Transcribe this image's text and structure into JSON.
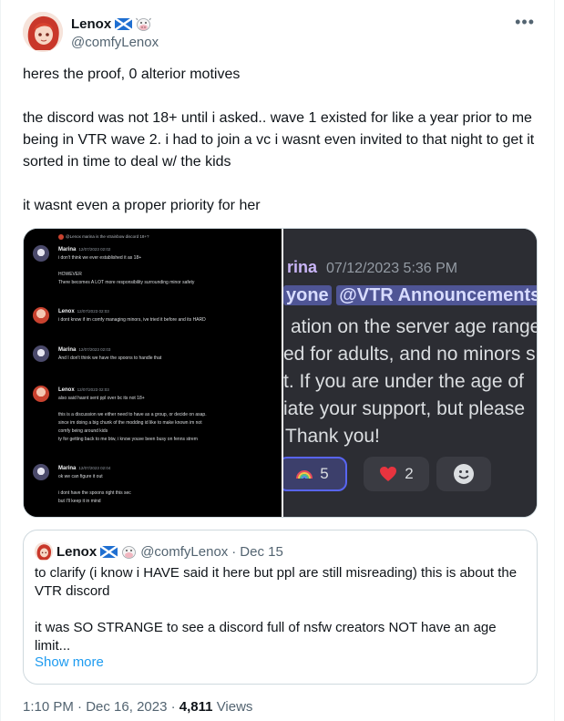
{
  "author": {
    "display_name": "Lenox",
    "handle": "@comfyLenox",
    "name_emojis": [
      "scotland-flag-icon",
      "cow-icon"
    ]
  },
  "more_label": "•••",
  "tweet": {
    "paragraphs": [
      "heres the proof, 0 alterior motives",
      "the discord was not 18+ until i asked.. wave 1 existed for like a year prior to me being in VTR wave 2. i had to join a vc i wasnt even invited to that night to get it sorted in time to deal w/ the kids",
      "it wasnt even a proper priority for her"
    ]
  },
  "media": {
    "left_dm": {
      "reply_line": "@Lenox  marina is the vtrainbow discord 18+?",
      "messages": [
        {
          "name": "Marina",
          "time": "12/07/2023 02:02",
          "lines": [
            "i don't think we ever established it as 18+",
            "",
            "HOWEVER",
            "There becomes A LOT more responsibility surrounding minor safety"
          ]
        },
        {
          "name": "Lenox",
          "time": "12/07/2023 02:03",
          "lines": [
            "i dont know if im comfy managing minors, ive tried it before and its HARD"
          ]
        },
        {
          "name": "Marina",
          "time": "12/07/2023 02:03",
          "lines": [
            "And I don't think we have the spoons to handle that"
          ]
        },
        {
          "name": "Lenox",
          "time": "12/07/2023 02:03",
          "lines": [
            "also said       hasnt sent ppl over bc its not 18+",
            "",
            "this is a discussion we either need to have as a group, or decide on asap.",
            "since im doing a big chunk of the modding id like to make known im not",
            "comfy being around kids",
            "ty for getting back to me btw, i know youve been busy on fenns strem"
          ]
        },
        {
          "name": "Marina",
          "time": "12/07/2023 02:04",
          "lines": [
            "ok we can figure it out",
            "",
            "i dont have the spoons right this sec",
            "but I'll keep it in mind"
          ]
        }
      ]
    },
    "right_announcement": {
      "name_fragment": "rina",
      "timestamp": "07/12/2023 5:36 PM",
      "mention_prefix": "yone",
      "mention": "@VTR Announcements",
      "lines": [
        "ation on the server age range",
        "ed for adults, and no minors s",
        "t. If you are under the age of",
        "iate your support, but please",
        "Thank you!"
      ],
      "reactions": [
        {
          "emoji": "rainbow-icon",
          "count": "5"
        },
        {
          "emoji": "heart-icon",
          "count": "2"
        },
        {
          "emoji": "smiley-icon",
          "count": ""
        }
      ]
    }
  },
  "quote": {
    "display_name": "Lenox",
    "handle": "@comfyLenox",
    "separator": "·",
    "date": "Dec 15",
    "paragraphs": [
      "to clarify (i know i HAVE said it here but ppl are still misreading) this is about the VTR discord",
      "it was SO STRANGE to see a discord full of nsfw creators NOT have an age limit..."
    ],
    "show_more": "Show more"
  },
  "meta": {
    "time": "1:10 PM",
    "separator": "·",
    "date": "Dec 16, 2023",
    "separator2": "·",
    "views_count": "4,811",
    "views_label": "Views"
  }
}
